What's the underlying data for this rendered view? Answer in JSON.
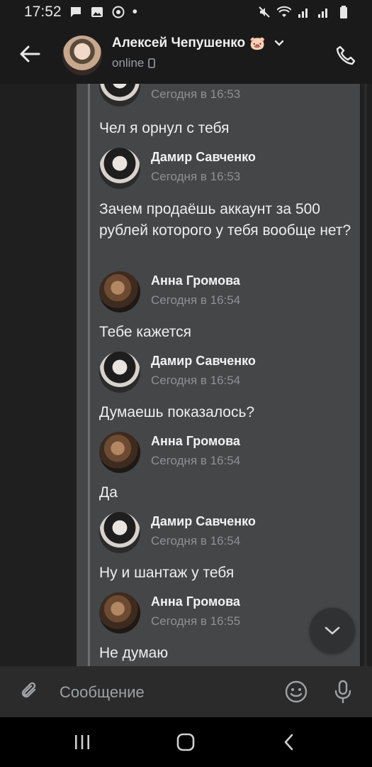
{
  "status_bar": {
    "time": "17:52",
    "dot": "•"
  },
  "header": {
    "title": "Алексей Чепушенко",
    "title_emoji": "🐷",
    "status": "online"
  },
  "messages": [
    {
      "type": "meta_partial",
      "time": "Сегодня в 16:53"
    },
    {
      "type": "text",
      "text": "Чел я орнул с тебя"
    },
    {
      "type": "author",
      "name": "Дамир Савченко",
      "time": "Сегодня в 16:53",
      "avatar": "damir"
    },
    {
      "type": "text",
      "text": "Зачем продаёшь аккаунт за 500 рублей которого у тебя вообще нет?"
    },
    {
      "type": "author",
      "name": "Анна Громова",
      "time": "Сегодня в 16:54",
      "avatar": "anna"
    },
    {
      "type": "text",
      "text": "Тебе кажется"
    },
    {
      "type": "author",
      "name": "Дамир Савченко",
      "time": "Сегодня в 16:54",
      "avatar": "damir"
    },
    {
      "type": "text",
      "text": "Думаешь показалось?"
    },
    {
      "type": "author",
      "name": "Анна Громова",
      "time": "Сегодня в 16:54",
      "avatar": "anna"
    },
    {
      "type": "text",
      "text": "Да"
    },
    {
      "type": "author",
      "name": "Дамир Савченко",
      "time": "Сегодня в 16:54",
      "avatar": "damir"
    },
    {
      "type": "text",
      "text": "Ну и шантаж у тебя"
    },
    {
      "type": "author",
      "name": "Анна Громова",
      "time": "Сегодня в 16:55",
      "avatar": "anna"
    },
    {
      "type": "text",
      "text": "Не думаю"
    }
  ],
  "composer": {
    "placeholder": "Сообщение"
  },
  "icons": {
    "back": "arrow-left-icon",
    "phone": "phone-icon",
    "attach": "paperclip-icon",
    "emoji": "smile-icon",
    "mic": "microphone-icon",
    "scroll_down": "chevron-down-icon"
  },
  "colors": {
    "background": "#1a1a1a",
    "bubble": "#454647",
    "composer": "#2b2b2c",
    "muted_text": "#8d9196"
  }
}
